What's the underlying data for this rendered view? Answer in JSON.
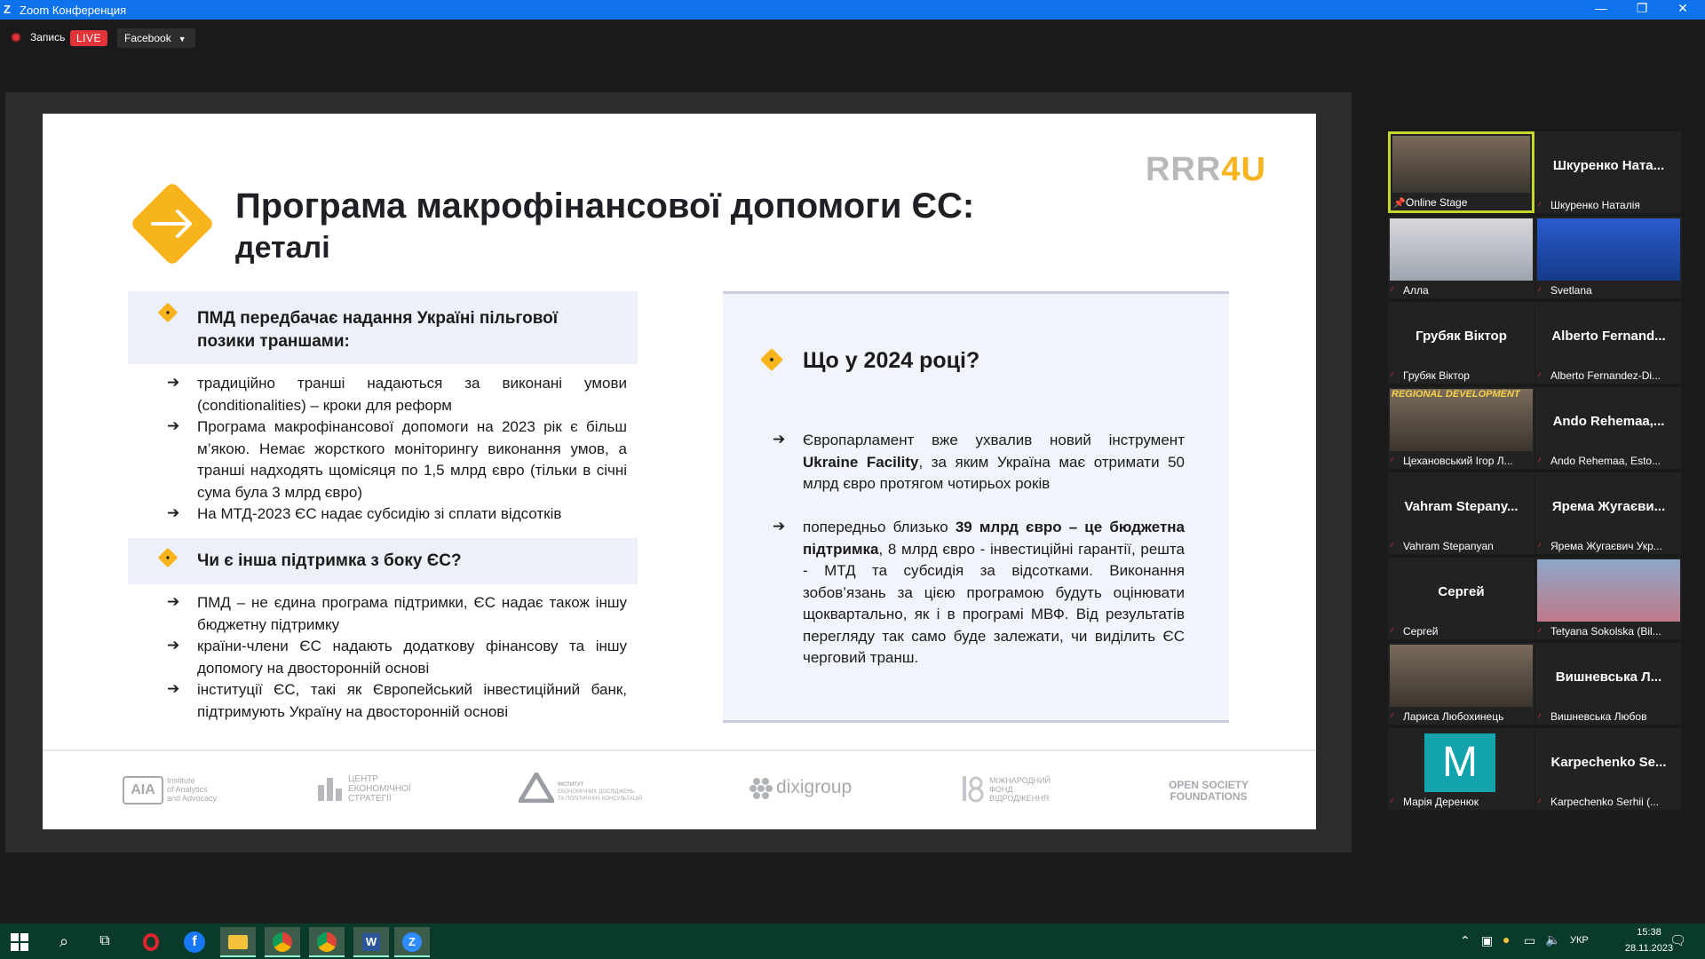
{
  "window": {
    "title": "Zoom Конференция",
    "minimize": "—",
    "restore": "❐",
    "close": "✕"
  },
  "topbar": {
    "record_label": "Запись",
    "live_label": "LIVE",
    "stream_target": "Facebook"
  },
  "slide": {
    "title": "Програма макрофінансової допомоги ЄС:",
    "subtitle": "деталі",
    "brand_prefix": "RRR",
    "brand_suffix": "4U",
    "left": {
      "section1_title": "ПМД передбачає надання Україні пільгової позики траншами:",
      "section1_items": [
        "традиційно транші надаються за виконані умови (conditionalities) – кроки для реформ",
        "Програма макрофінансової допомоги на 2023 рік є більш м’якою. Немає жорсткого моніторингу виконання умов, а транші надходять щомісяця по 1,5 млрд євро (тільки в січні сума була 3 млрд євро)",
        "На МТД-2023 ЄС надає субсидію зі сплати відсотків"
      ],
      "section2_title": "Чи є інша підтримка з боку ЄС?",
      "section2_items": [
        "ПМД – не єдина програма підтримки, ЄС надає також іншу бюджетну підтримку",
        "країни-члени ЄС надають додаткову фінансову та іншу допомогу на двосторонній основі",
        "інституції ЄС, такі як Європейський інвестиційний банк, підтримують Україну на двосторонній основі"
      ]
    },
    "right": {
      "title": "Що у 2024 році?",
      "item1_a": "Європарламент вже ухвалив новий інструмент ",
      "item1_b": "Ukraine Facility",
      "item1_c": ", за яким Україна має отримати 50 млрд євро протягом чотирьох років",
      "item2_a": "попередньо близько ",
      "item2_b": "39 млрд євро – це бюджетна підтримка",
      "item2_c": ", 8 млрд євро - інвестиційні гарантії, решта - МТД та субсидія за відсотками. Виконання зобов’язань за цією програмою будуть оцінювати щоквартально, як і в програмі МВФ. Від результатів перегляду так само буде залежати,  чи виділить ЄС черговий транш."
    },
    "logos": {
      "aia": [
        "Institute",
        "of Analytics",
        "and Advocacy"
      ],
      "ces": [
        "ЦЕНТР",
        "ЕКОНОМІЧНОЇ",
        "СТРАТЕГІЇ"
      ],
      "ier": [
        "ІНСТИТУТ",
        "ЕКОНОМІЧНИХ ДОСЛІДЖЕНЬ",
        "ТА ПОЛІТИЧНИХ КОНСУЛЬТАЦІЙ"
      ],
      "dixi": "dixigroup",
      "irf": [
        "МІЖНАРОДНИЙ",
        "ФОНД",
        "ВІДРОДЖЕННЯ"
      ],
      "osf": [
        "OPEN SOCIETY",
        "FOUNDATIONS"
      ]
    }
  },
  "participants": [
    {
      "name": "",
      "label": "Online Stage",
      "video": true,
      "pinned": true
    },
    {
      "name": "Шкуренко Ната...",
      "label": "Шкуренко Наталія"
    },
    {
      "name": "",
      "label": "Алла",
      "video": true
    },
    {
      "name": "",
      "label": "Svetlana",
      "video": true
    },
    {
      "name": "Грубяк Віктор",
      "label": "Грубяк Віктор"
    },
    {
      "name": "Alberto Fernand...",
      "label": "Alberto Fernandez-Di..."
    },
    {
      "name": "",
      "label": "Цехановський Ігор Л...",
      "video": true,
      "video_text": "REGIONAL DEVELOPMENT"
    },
    {
      "name": "Ando Rehemaa,...",
      "label": "Ando Rehemaa, Esto..."
    },
    {
      "name": "Vahram Stepany...",
      "label": "Vahram Stepanyan"
    },
    {
      "name": "Ярема Жугаєви...",
      "label": "Ярема Жугаєвич Укр..."
    },
    {
      "name": "Сергей",
      "label": "Сергей"
    },
    {
      "name": "",
      "label": "Tetyana Sokolska (Bil...",
      "video": true
    },
    {
      "name": "",
      "label": "Лариса Любохинець",
      "video": true
    },
    {
      "name": "Вишневська Л...",
      "label": "Вишневська Любов"
    },
    {
      "name": "",
      "label": "Марія Деренюк",
      "avatar_letter": "M"
    },
    {
      "name": "Karpechenko Se...",
      "label": "Karpechenko Serhii (..."
    }
  ],
  "taskbar": {
    "lang": "УКР",
    "time": "15:38",
    "date": "28.11.2023"
  },
  "colors": {
    "accent": "#f8b41c",
    "zoom_blue": "#0e72ed",
    "live_red": "#e0343a"
  }
}
